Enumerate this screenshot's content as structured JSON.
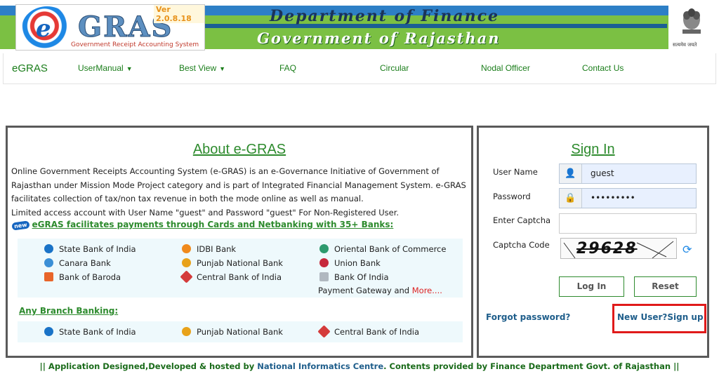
{
  "header": {
    "version": "Ver 2.0.8.18",
    "logo_e": "e",
    "logo_gras": "GRAS",
    "logo_subtitle": "Government Receipt Accounting System",
    "department": "Department of Finance",
    "government": "Government of Rajasthan",
    "emblem_text": "सत्यमेव जयते"
  },
  "nav": {
    "brand": "eGRAS",
    "items": [
      "UserManual",
      "Best View",
      "FAQ",
      "Circular",
      "Nodal Officer",
      "Contact Us"
    ]
  },
  "about": {
    "title": "About e-GRAS",
    "paragraph1": "Online Government Receipts Accounting System (e-GRAS) is an e-Governance Initiative of Government of Rajasthan under Mission Mode Project category and is part of Integrated Financial Management System. e-GRAS facilitates collection of tax/non tax revenue in both the mode online as well as manual.",
    "paragraph2": "Limited access account with User Name \"guest\" and Password \"guest\" For Non-Registered User.",
    "new_badge": "new",
    "cards_link": "eGRAS facilitates payments through Cards and Netbanking with 35+ Banks:",
    "banks": [
      "State Bank of India",
      "IDBI Bank",
      "Oriental Bank of Commerce",
      "Canara Bank",
      "Punjab National Bank",
      "Union Bank",
      "Bank of Baroda",
      "Central Bank of India",
      "Bank Of India"
    ],
    "gateway_text": "Payment Gateway and",
    "more_link": "More....",
    "branch_title": "Any Branch Banking:",
    "branch_banks": [
      "State Bank of India",
      "Punjab National Bank",
      "Central Bank of India"
    ]
  },
  "signin": {
    "title": "Sign In",
    "username_label": "User Name",
    "username_value": "guest",
    "password_label": "Password",
    "password_value": "•••••••••",
    "captcha_label": "Enter Captcha",
    "captcha_code_label": "Captcha Code",
    "captcha_value": "29628",
    "login_button": "Log In",
    "reset_button": "Reset",
    "forgot_link": "Forgot password?",
    "signup_link": "New User?Sign up"
  },
  "footer": {
    "part1": "|| Application Designed,Developed & hosted by",
    "nic": "National Informatics Centre",
    "part2": ". Contents provided by Finance Department Govt. of Rajasthan ||"
  },
  "colors": {
    "accent_green": "#2e8b2e",
    "banner_green": "#7bc043",
    "banner_blue": "#2d7fc6",
    "link_blue": "#1f5e8b",
    "highlight_red": "#e01a1a"
  }
}
